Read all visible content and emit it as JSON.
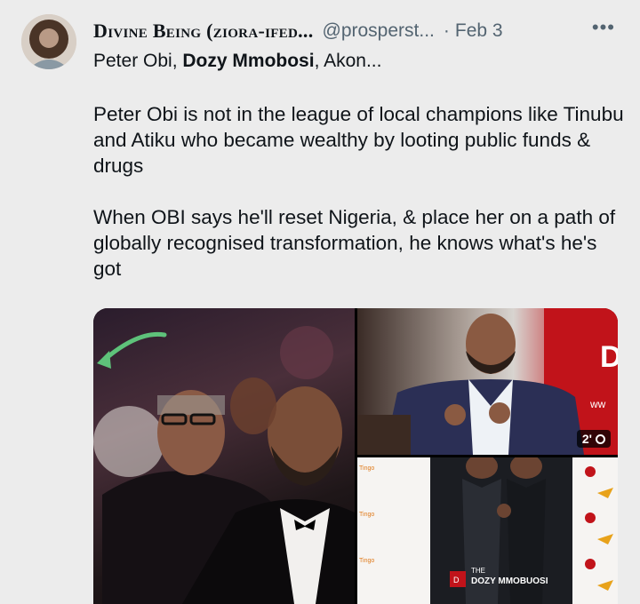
{
  "tweet": {
    "display_name": "Divine Being (ziora-ifed...",
    "handle": "@prosperst...",
    "separator": "·",
    "date": "Feb 3",
    "more_label": "•••",
    "replying_to": {
      "first": "Peter Obi, ",
      "highlight": "Dozy Mmobosi",
      "rest": ", Akon..."
    },
    "paragraphs": [
      "Peter Obi is not in the league of local champions like Tinubu and Atiku who became wealthy by looting public funds & drugs",
      "When OBI says he'll reset Nigeria, & place her on a path of globally recognised transformation, he knows what's he's got"
    ]
  },
  "media": {
    "video_duration": "2'",
    "backdrop_letter": "D",
    "backdrop_partial": "ww",
    "banner_logo": "DOZY MMOBUOSI",
    "banner_logo_line1": "THE",
    "banner_brand": "Tingo"
  },
  "colors": {
    "background": "#ececec",
    "text": "#0f1419",
    "secondary": "#536471",
    "arrow_green": "#5ec27a",
    "brand_red": "#c1131a"
  }
}
